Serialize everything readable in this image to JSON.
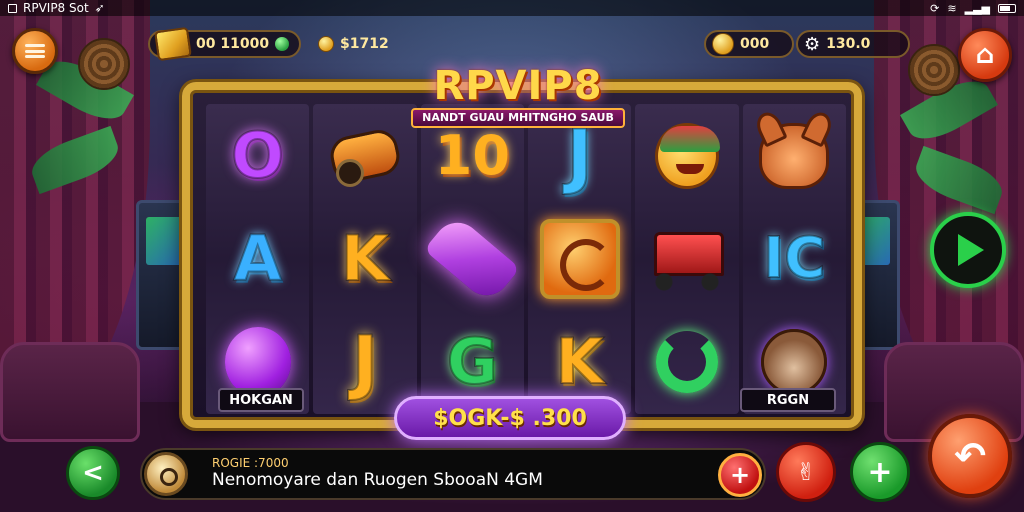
{
  "status_bar": {
    "app_name": "RPVIP8 Sot",
    "icons": [
      "screen-icon",
      "arrow-icon",
      "sync-icon",
      "wifi-icon",
      "signal-icon",
      "battery-icon"
    ]
  },
  "hud": {
    "balance": "00 11000",
    "coins": "$1712",
    "bet": "000",
    "total": "130.0"
  },
  "logo": {
    "title": "RPVIP8",
    "subtitle": "NANDT GUAU MHITNGHO SAUB"
  },
  "reels": [
    [
      "o-letter",
      "a-letter",
      "purple-gem"
    ],
    [
      "cannon",
      "k-letter",
      "j-letter"
    ],
    [
      "ten",
      "crystal",
      "g-letter"
    ],
    [
      "j-blue-letter",
      "orange-coin",
      "k-gold-letter"
    ],
    [
      "jester-face",
      "red-cart",
      "green-swirl"
    ],
    [
      "fox-creature",
      "ice-letter",
      "monkey-face"
    ]
  ],
  "symbols": {
    "o": "O",
    "a": "A",
    "k": "K",
    "j": "J",
    "ten": "10",
    "g": "G",
    "j_blue": "J",
    "k_gold": "K",
    "ice": "IC"
  },
  "reel_tags": {
    "left": "HOKGAN",
    "right": "RGGN"
  },
  "win": {
    "amount": "$OGK-$ .300"
  },
  "info": {
    "label": "ROGIE :7000",
    "text": "Nenomoyare dan Ruogen SbooaN 4GM"
  },
  "buttons": {
    "back": "<",
    "add": "+",
    "plus": "+",
    "spin": "↶",
    "home": "⌂"
  },
  "colors": {
    "accent_gold": "#d7a93a",
    "win_purple": "#8a30c8",
    "play_green": "#2ad04a",
    "spin_orange": "#e04010"
  }
}
